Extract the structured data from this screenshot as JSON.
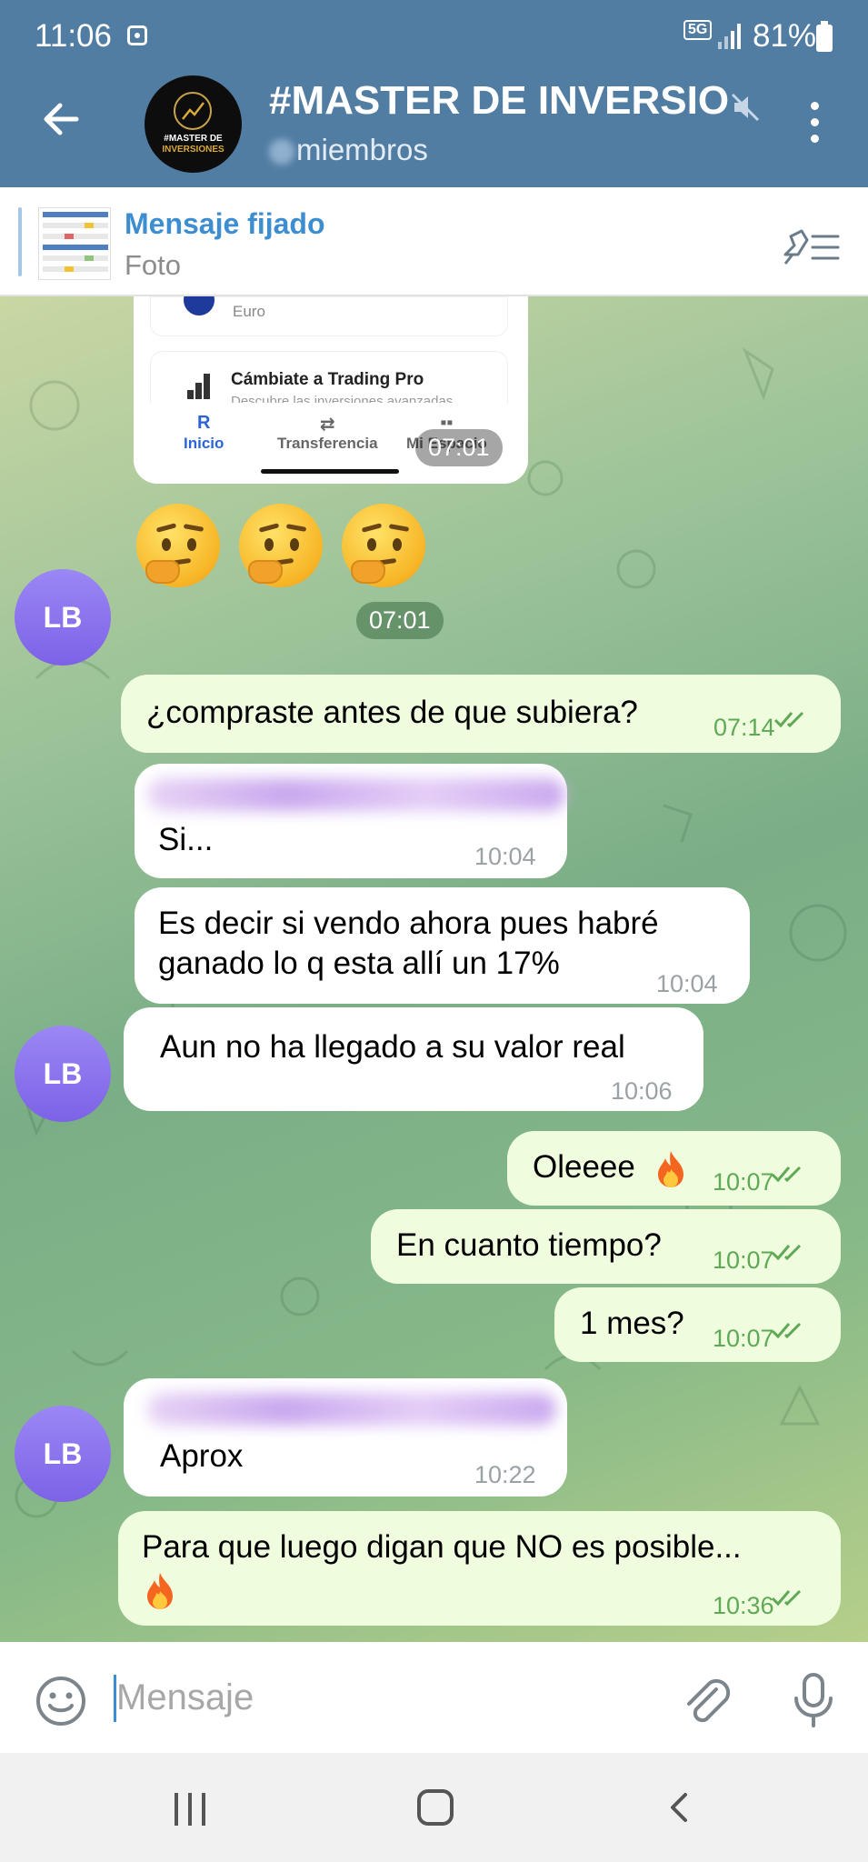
{
  "status_bar": {
    "time": "11:06",
    "network": "5G",
    "battery": "81%"
  },
  "header": {
    "title": "#MASTER DE INVERSIO",
    "subtitle": "miembros",
    "avatar_text_top": "#MASTER DE",
    "avatar_text_bottom": "INVERSIONES"
  },
  "pinned": {
    "title": "Mensaje fijado",
    "subtitle": "Foto"
  },
  "image_message": {
    "card1_text": "Euro",
    "card2_title": "Cámbiate a Trading Pro",
    "card2_sub": "Descubre las inversiones avanzadas",
    "tabs": [
      "Inicio",
      "Transferencia",
      "Mi Espacio"
    ],
    "time": "07:01"
  },
  "emoji_message": {
    "time": "07:01"
  },
  "avatar_initials": "LB",
  "messages": [
    {
      "dir": "out",
      "text": "¿compraste antes de que subiera?",
      "time": "07:14"
    },
    {
      "dir": "in",
      "text": "Si...",
      "time": "10:04"
    },
    {
      "dir": "in",
      "text_line1": "Es decir si vendo ahora pues habré",
      "text_line2": "ganado lo q esta allí un 17%",
      "time": "10:04"
    },
    {
      "dir": "in",
      "text": "Aun no ha llegado a su valor real",
      "time": "10:06"
    },
    {
      "dir": "out",
      "text": "Oleeee",
      "time": "10:07"
    },
    {
      "dir": "out",
      "text": "En cuanto tiempo?",
      "time": "10:07"
    },
    {
      "dir": "out",
      "text": "1 mes?",
      "time": "10:07"
    },
    {
      "dir": "in",
      "text": "Aprox",
      "time": "10:22"
    },
    {
      "dir": "out",
      "text": "Para que luego digan que NO es posible...",
      "time": "10:36"
    }
  ],
  "input": {
    "placeholder": "Mensaje"
  },
  "colors": {
    "header": "#527da3",
    "accent": "#3d8ed0",
    "out_bubble": "#effdde",
    "out_time": "#5fa956",
    "avatar": "#8b73ee"
  }
}
